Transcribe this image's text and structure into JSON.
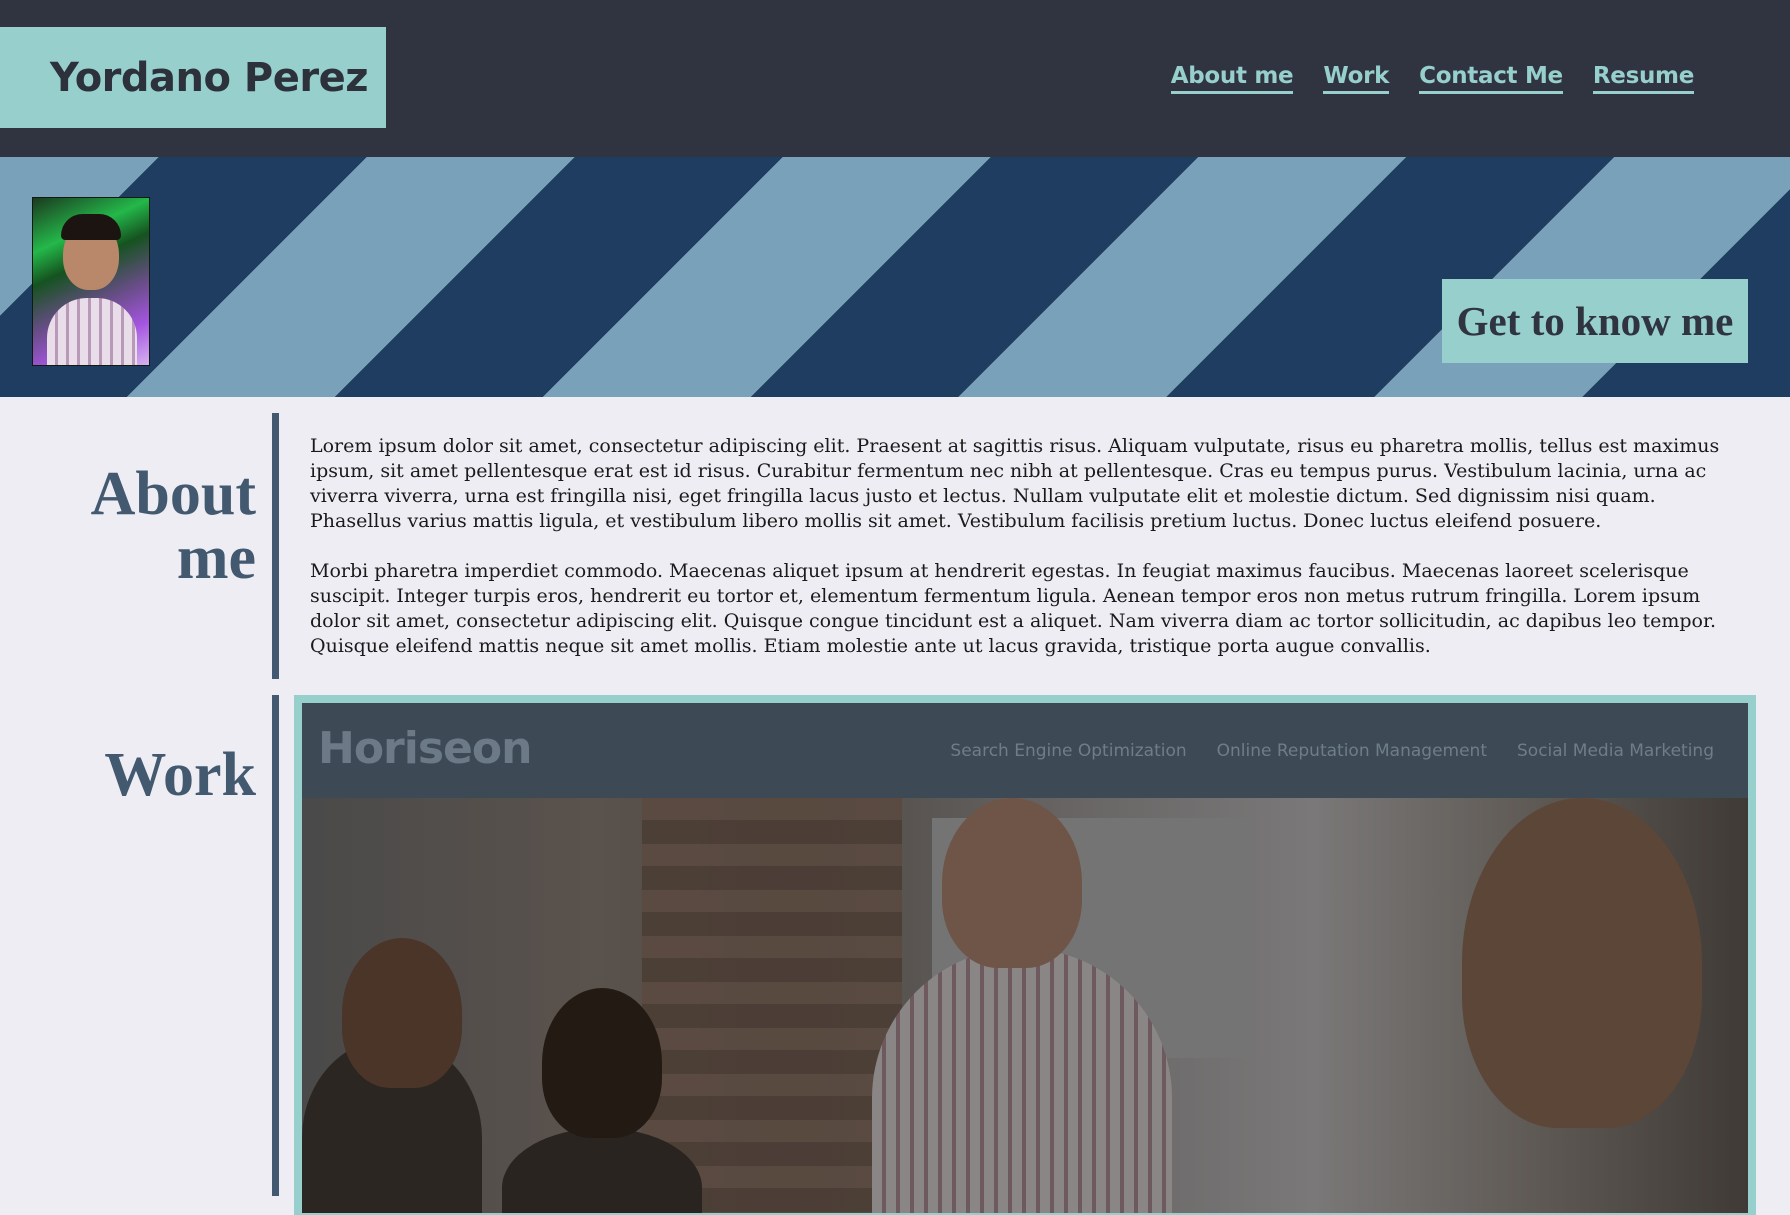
{
  "header": {
    "brand": "Yordano Perez",
    "nav": [
      "About me",
      "Work",
      "Contact Me",
      "Resume"
    ]
  },
  "hero": {
    "avatar_alt": "profile photo",
    "cta": "Get to know me"
  },
  "about": {
    "title_line1": "About",
    "title_line2": "me",
    "paragraphs": [
      "Lorem ipsum dolor sit amet, consectetur adipiscing elit. Praesent at sagittis risus. Aliquam vulputate, risus eu pharetra mollis, tellus est maximus ipsum, sit amet pellentesque erat est id risus. Curabitur fermentum nec nibh at pellentesque. Cras eu tempus purus. Vestibulum lacinia, urna ac viverra viverra, urna est fringilla nisi, eget fringilla lacus justo et lectus. Nullam vulputate elit et molestie dictum. Sed dignissim nisi quam. Phasellus varius mattis ligula, et vestibulum libero mollis sit amet. Vestibulum facilisis pretium luctus. Donec luctus eleifend posuere.",
      "Morbi pharetra imperdiet commodo. Maecenas aliquet ipsum at hendrerit egestas. In feugiat maximus faucibus. Maecenas laoreet scelerisque suscipit. Integer turpis eros, hendrerit eu tortor et, elementum fermentum ligula. Aenean tempor eros non metus rutrum fringilla. Lorem ipsum dolor sit amet, consectetur adipiscing elit. Quisque congue tincidunt est a aliquet. Nam viverra diam ac tortor sollicitudin, ac dapibus leo tempor. Quisque eleifend mattis neque sit amet mollis. Etiam molestie ante ut lacus gravida, tristique porta augue convallis."
    ]
  },
  "work": {
    "title": "Work",
    "project": {
      "logo": "Horiseon",
      "nav": [
        "Search Engine Optimization",
        "Online Reputation Management",
        "Social Media Marketing"
      ]
    }
  },
  "colors": {
    "header_bg": "#2f3440",
    "accent": "#96cfcc",
    "stripe_dark": "#1f3d60",
    "stripe_light": "#79a1ba",
    "heading": "#425970",
    "page_bg": "#efedf4"
  }
}
